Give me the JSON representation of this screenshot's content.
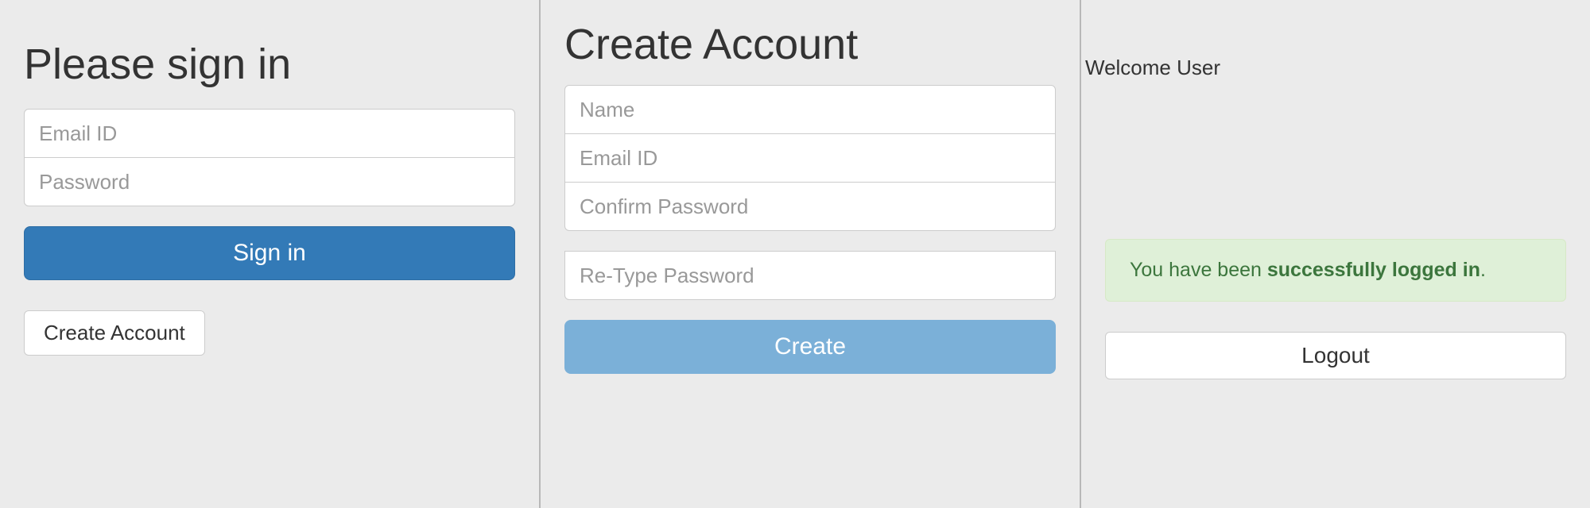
{
  "signin": {
    "heading": "Please sign in",
    "email_placeholder": "Email ID",
    "password_placeholder": "Password",
    "signin_button": "Sign in",
    "create_account_button": "Create Account"
  },
  "create": {
    "heading": "Create Account",
    "name_placeholder": "Name",
    "email_placeholder": "Email ID",
    "confirm_password_placeholder": "Confirm Password",
    "retype_password_placeholder": "Re-Type Password",
    "create_button": "Create"
  },
  "welcome": {
    "greeting": "Welcome User",
    "alert_prefix": "You have been ",
    "alert_strong": "successfully logged in",
    "alert_suffix": ".",
    "logout_button": "Logout"
  }
}
